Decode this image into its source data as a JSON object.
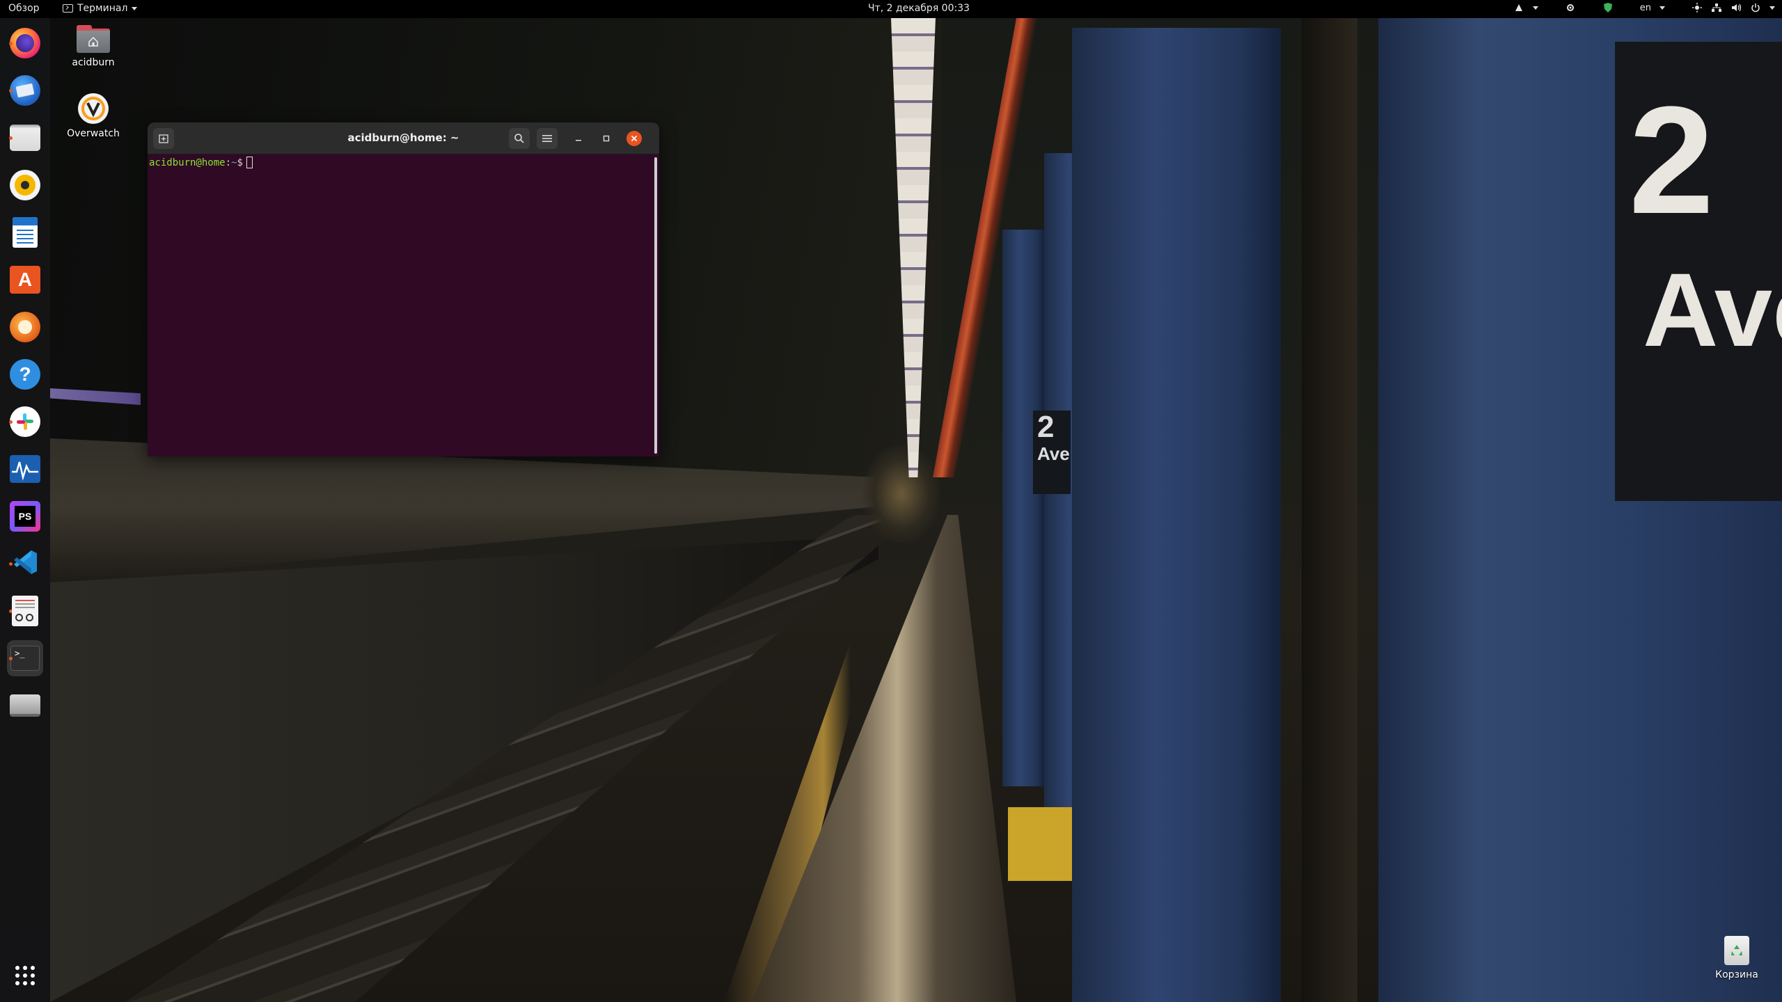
{
  "topbar": {
    "activities": "Обзор",
    "app_menu_label": "Терминал",
    "clock": "Чт, 2 декабря  00:33",
    "keyboard_layout": "en"
  },
  "dock": {
    "items": [
      {
        "name": "Firefox",
        "icon": "firefox-icon",
        "running": true
      },
      {
        "name": "Thunderbird",
        "icon": "thunderbird-icon",
        "running": true
      },
      {
        "name": "Files",
        "icon": "files-icon",
        "running": true
      },
      {
        "name": "Rhythmbox",
        "icon": "rhythmbox-icon",
        "running": false
      },
      {
        "name": "LibreOffice Writer",
        "icon": "writer-icon",
        "running": false
      },
      {
        "name": "Ubuntu Software",
        "icon": "software-icon",
        "running": false
      },
      {
        "name": "Ubuntu Cleaner",
        "icon": "cleaner-icon",
        "running": false
      },
      {
        "name": "Help",
        "icon": "help-icon",
        "running": false
      },
      {
        "name": "Slack",
        "icon": "slack-icon",
        "running": true
      },
      {
        "name": "System Monitor",
        "icon": "system-monitor-icon",
        "running": false
      },
      {
        "name": "PhpStorm",
        "icon": "phpstorm-icon",
        "running": false
      },
      {
        "name": "VS Code",
        "icon": "vscode-icon",
        "running": true
      },
      {
        "name": "Document Viewer",
        "icon": "document-viewer-icon",
        "running": true
      },
      {
        "name": "Terminal",
        "icon": "terminal-icon",
        "running": true,
        "active": true
      },
      {
        "name": "Drive",
        "icon": "drive-icon",
        "running": false
      }
    ],
    "show_apps_icon": "show-applications-icon"
  },
  "desktop": {
    "icons": [
      {
        "label": "acidburn",
        "icon": "home-folder-icon"
      },
      {
        "label": "Overwatch",
        "icon": "overwatch-icon"
      },
      {
        "label": "Корзина",
        "icon": "trash-icon"
      }
    ]
  },
  "terminal": {
    "title": "acidburn@home: ~",
    "prompt_user": "acidburn@home",
    "prompt_sep": ":",
    "prompt_path": "~",
    "prompt_symbol": "$",
    "background": "#300a24",
    "accent": "#e95420"
  },
  "wallpaper": {
    "sign_large_number": "2",
    "sign_large_text": "Ave",
    "sign_small_number": "2",
    "sign_small_text": "Ave"
  }
}
